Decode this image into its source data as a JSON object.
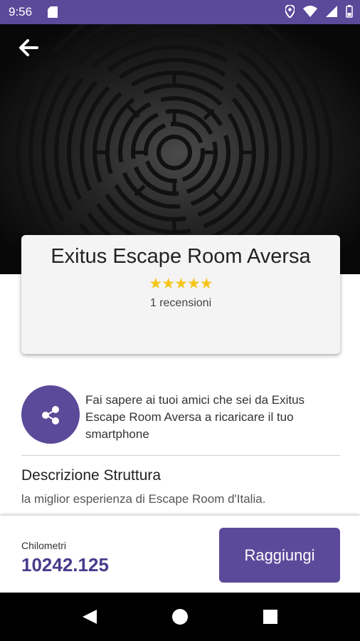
{
  "status_bar": {
    "time": "9:56"
  },
  "hero": {
    "title": "Exitus Escape Room Aversa",
    "rating": 5,
    "stars": "★★★★★",
    "reviews": "1 recensioni"
  },
  "share": {
    "text": "Fai sapere ai tuoi amici che sei da Exitus Escape Room Aversa a ricaricare il tuo smartphone"
  },
  "description": {
    "title": "Descrizione Struttura",
    "text": "la miglior esperienza di Escape Room d'Italia."
  },
  "footer": {
    "km_label": "Chilometri",
    "km_value": "10242.125",
    "button_label": "Raggiungi"
  },
  "colors": {
    "accent": "#5b4a9a",
    "star": "#f5c518",
    "km_value": "#4a3a8c"
  }
}
